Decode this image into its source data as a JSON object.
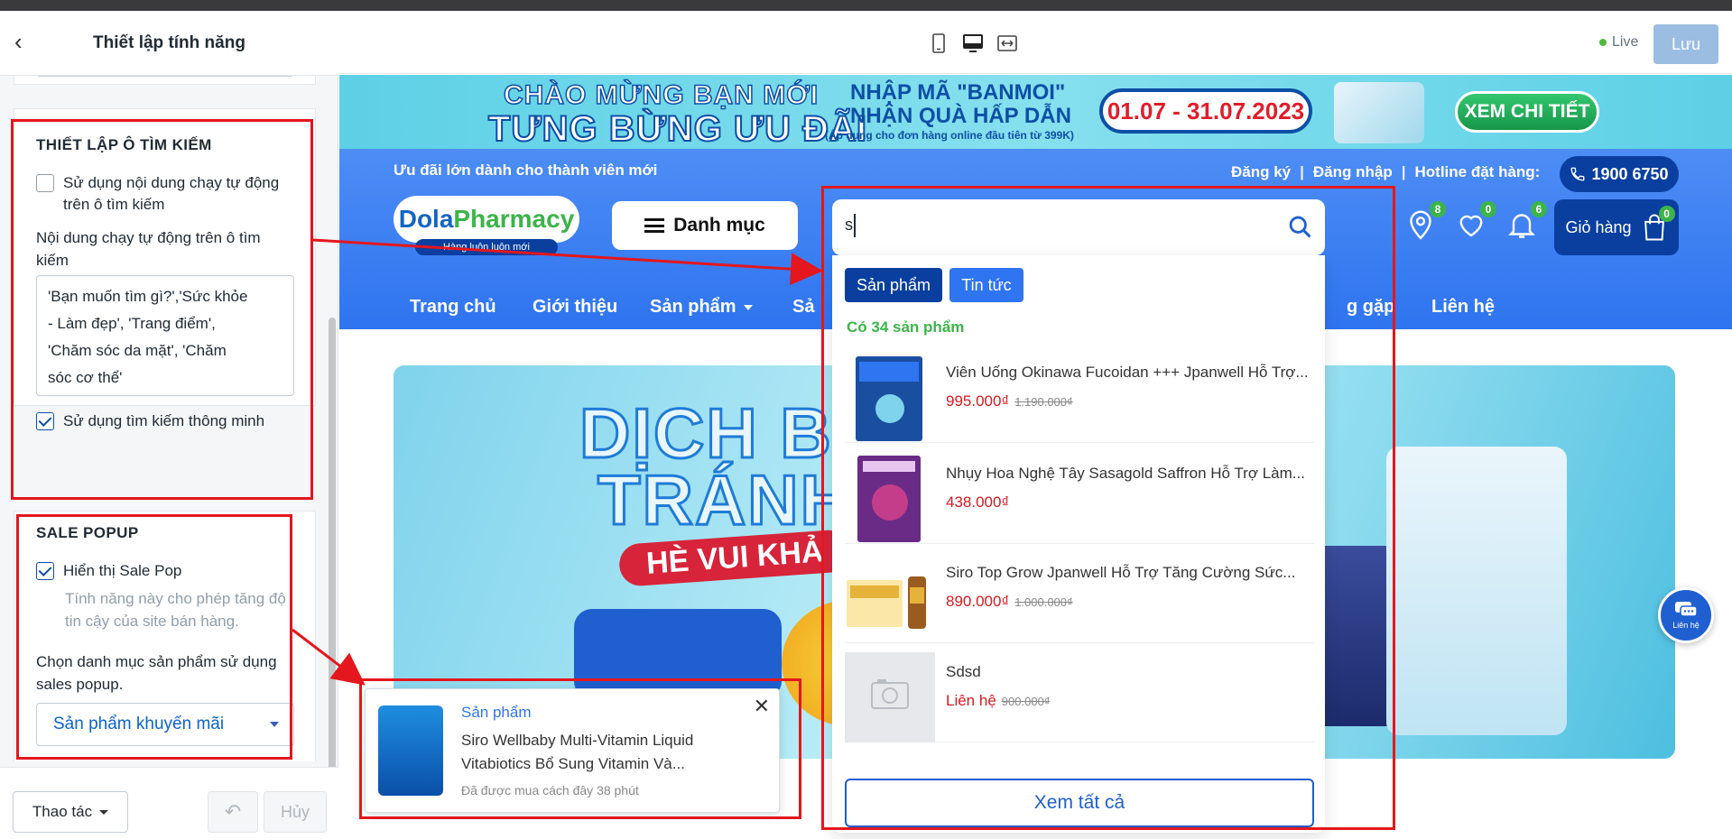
{
  "panel": {
    "title": "Thiết lập tính năng",
    "search_section": {
      "title": "THIẾT LẬP Ô TÌM KIẾM",
      "auto_run_checkbox": {
        "label_line1": "Sử dụng nội dung chạy tự động",
        "label_line2": "trên ô tìm kiếm",
        "checked": false
      },
      "auto_text_label_line1": "Nội dung chạy tự động trên ô tìm",
      "auto_text_label_line2": "kiếm",
      "auto_text_value": "'Bạn muốn tìm gì?','Sức khỏe\n- Làm đẹp', 'Trang điểm',\n'Chăm sóc da mặt', 'Chăm\nsóc cơ thể'",
      "smart_search_checkbox": {
        "label": "Sử dụng tìm kiếm thông minh",
        "checked": true
      }
    },
    "sale_section": {
      "title": "SALE POPUP",
      "show_checkbox": {
        "label": "Hiển thị Sale Pop",
        "checked": true
      },
      "help_line1": "Tính năng này cho phép tăng độ",
      "help_line2": "tin cậy của site bán hàng.",
      "category_label_line1": "Chọn danh mục sản phẩm sử dụng",
      "category_label_line2": "sales popup.",
      "category_value": "Sản phẩm khuyến mãi"
    },
    "footer": {
      "action_label": "Thao tác",
      "cancel_label": "Hủy"
    }
  },
  "editbar": {
    "live_label": "Live",
    "save_label": "Lưu"
  },
  "site": {
    "promo": {
      "line1": "CHÀO MỪNG BẠN MỚI",
      "line2": "TƯNG BỪNG ƯU ĐÃI",
      "code_line1": "NHẬP MÃ \"BANMOI\"",
      "code_line2": "NHẬN QUÀ HẤP DẪN",
      "code_note": "(Áp dụng cho đơn hàng online đầu tiên từ 399K)",
      "date": "01.07 - 31.07.2023",
      "cta": "XEM CHI TIẾT"
    },
    "header": {
      "tagline": "Ưu đãi lớn dành cho thành viên mới",
      "register": "Đăng ký",
      "login": "Đăng nhập",
      "hotline_label": "Hotline đặt hàng:",
      "hotline_number": "1900 6750",
      "logo_part1": "Dola",
      "logo_part2": "Pharmacy",
      "logo_sub": "Hàng luôn luôn mới",
      "category_button": "Danh mục",
      "location_count": "8",
      "wishlist_count": "0",
      "notify_count": "6",
      "cart_label": "Giỏ hàng",
      "cart_count": "0"
    },
    "nav": [
      {
        "label": "Trang chủ"
      },
      {
        "label": "Giới thiệu"
      },
      {
        "label": "Sản phẩm"
      },
      {
        "label": "Sả"
      },
      {
        "label": "g gặp"
      },
      {
        "label": "Liên hệ"
      }
    ],
    "hero": {
      "line1": "DỊCH B",
      "line2": "TRÁNH",
      "line3": "HÈ VUI KHẢ"
    },
    "fab_label": "Liên hệ",
    "search": {
      "query": "s",
      "tab_products": "Sản phẩm",
      "tab_news": "Tin tức",
      "result_count": "Có 34 sản phẩm",
      "results": [
        {
          "name": "Viên Uống Okinawa Fucoidan +++ Jpanwell Hỗ Trợ...",
          "price": "995.000₫",
          "old_price": "1.190.000₫",
          "thumb_color": "#1a4fa0"
        },
        {
          "name": "Nhụy Hoa Nghệ Tây Sasagold Saffron Hỗ Trợ Làm...",
          "price": "438.000₫",
          "old_price": "",
          "thumb_color": "#6a2b86"
        },
        {
          "name": "Siro Top Grow Jpanwell Hỗ Trợ Tăng Cường Sức...",
          "price": "890.000₫",
          "old_price": "1.000.000₫",
          "thumb_color": "#e6b23a"
        },
        {
          "name": "Sdsd",
          "price": "Liên hệ",
          "old_price": "900.000₫",
          "thumb_color": "#e6e8eb"
        }
      ],
      "see_all": "Xem tất cả"
    },
    "sale_popup": {
      "type": "Sản phẩm",
      "name_line1": "Siro Wellbaby Multi-Vitamin Liquid",
      "name_line2": "Vitabiotics Bổ Sung Vitamin Và...",
      "time": "Đã được mua cách đây 38 phút"
    }
  },
  "colors": {
    "annotation": "#e3171d",
    "primary": "#2f74f0",
    "dark_blue": "#0a3fa0",
    "green": "#3cb44a",
    "price_red": "#d71920"
  }
}
